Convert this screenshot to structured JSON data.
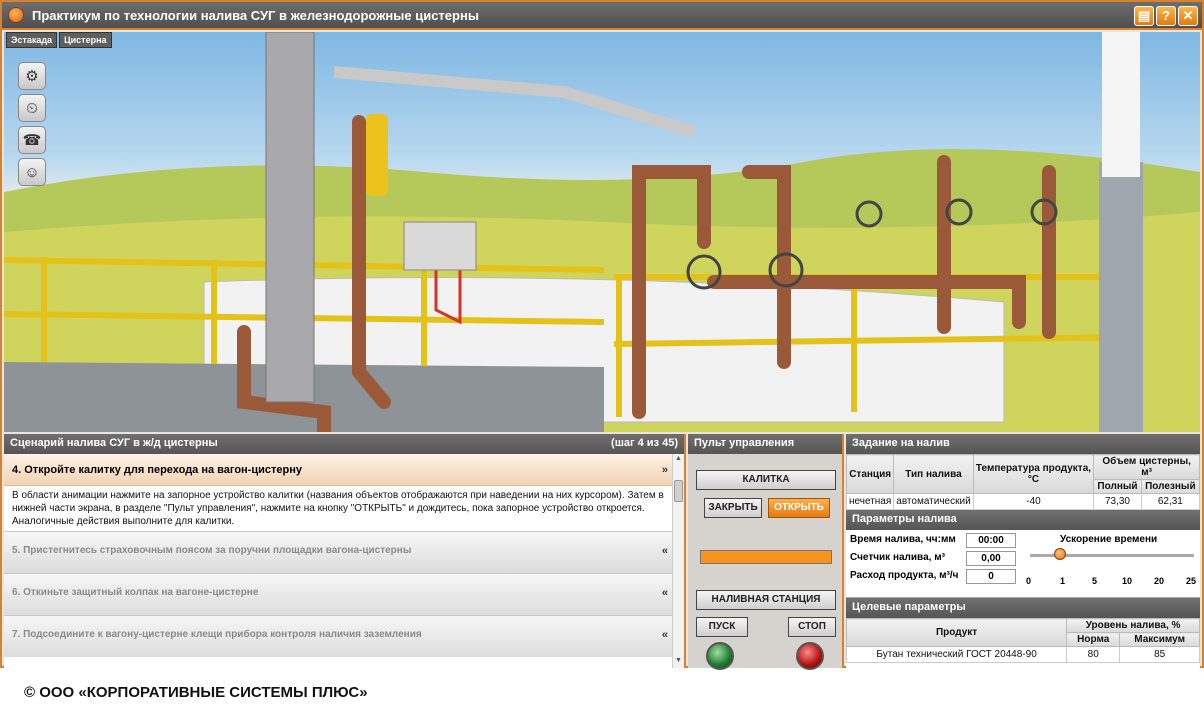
{
  "window": {
    "title": "Практикум по технологии налива СУГ в железнодорожные цистерны",
    "buttons": [
      "notes-icon",
      "help-icon",
      "close-icon"
    ]
  },
  "tabs": [
    "Эстакада",
    "Цистерна"
  ],
  "scene_tools": [
    "valve-wheel-icon",
    "pressure-gauge-icon",
    "phone-icon",
    "worker-icon"
  ],
  "scenario": {
    "title": "Сценарий налива СУГ в ж/д цистерны",
    "step_counter": "(шаг 4 из 45)",
    "active_step": "4.  Откройте калитку для перехода на вагон-цистерну",
    "active_desc": "В области анимации нажмите на запорное устройство калитки (названия объектов отображаются при наведении на них курсором). Затем в нижней части экрана, в разделе \"Пульт управления\", нажмите на кнопку \"ОТКРЫТЬ\" и дождитесь, пока запорное устройство откроется. Аналогичные действия выполните для калитки.",
    "steps": [
      "5.  Пристегнитесь страховочным поясом за поручни площадки вагона-цистерны",
      "6.  Откиньте защитный колпак на вагоне-цистерне",
      "7.  Подсоедините к вагону-цистерне клещи прибора контроля наличия заземления"
    ],
    "chev_down": "»",
    "chev_up": "«"
  },
  "control": {
    "title": "Пульт управления",
    "object": "КАЛИТКА",
    "close": "ЗАКРЫТЬ",
    "open": "ОТКРЫТЬ",
    "progress": 1.0,
    "station": "НАЛИВНАЯ СТАНЦИЯ",
    "start": "ПУСК",
    "stop": "СТОП"
  },
  "task": {
    "title": "Задание на налив",
    "headers": [
      "Станция",
      "Тип налива",
      "Температура продукта, °С",
      "Объем цистерны, м³",
      "Полный",
      "Полезный"
    ],
    "row": [
      "нечетная",
      "автоматический",
      "-40",
      "73,30",
      "62,31"
    ]
  },
  "params": {
    "title": "Параметры налива",
    "time_label": "Время налива, чч:мм",
    "time_value": "00:00",
    "counter_label": "Счетчик налива, м³",
    "counter_value": "0,00",
    "flow_label": "Расход продукта, м³/ч",
    "flow_value": "0",
    "accel_label": "Ускорение времени",
    "accel_ticks": [
      "0",
      "1",
      "5",
      "10",
      "20",
      "25"
    ],
    "accel_value": "1"
  },
  "target": {
    "title": "Целевые параметры",
    "headers": [
      "Продукт",
      "Уровень налива, %",
      "Норма",
      "Максимум"
    ],
    "row": [
      "Бутан технический ГОСТ 20448-90",
      "80",
      "85"
    ]
  },
  "copyright": "© ООО «КОРПОРАТИВНЫЕ СИСТЕМЫ ПЛЮС»"
}
